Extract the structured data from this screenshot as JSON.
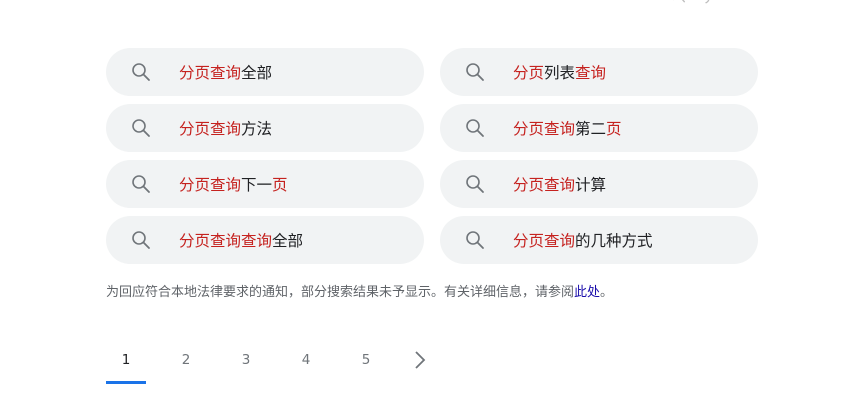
{
  "top_fragment": "ペ ア",
  "related_searches": [
    {
      "segments": [
        {
          "text": "分页查询",
          "hl": true
        },
        {
          "text": "全部",
          "hl": false
        }
      ]
    },
    {
      "segments": [
        {
          "text": "分页",
          "hl": true
        },
        {
          "text": "列表",
          "hl": false
        },
        {
          "text": "查询",
          "hl": true
        }
      ]
    },
    {
      "segments": [
        {
          "text": "分页查询",
          "hl": true
        },
        {
          "text": "方法",
          "hl": false
        }
      ]
    },
    {
      "segments": [
        {
          "text": "分页查询",
          "hl": true
        },
        {
          "text": "第二",
          "hl": false
        },
        {
          "text": "页",
          "hl": true
        }
      ]
    },
    {
      "segments": [
        {
          "text": "分页查询",
          "hl": true
        },
        {
          "text": "下一",
          "hl": false
        },
        {
          "text": "页",
          "hl": true
        }
      ]
    },
    {
      "segments": [
        {
          "text": "分页查询",
          "hl": true
        },
        {
          "text": "计算",
          "hl": false
        }
      ]
    },
    {
      "segments": [
        {
          "text": "分页查询查询",
          "hl": true
        },
        {
          "text": "全部",
          "hl": false
        }
      ]
    },
    {
      "segments": [
        {
          "text": "分页查询",
          "hl": true
        },
        {
          "text": "的几种方式",
          "hl": false
        }
      ]
    }
  ],
  "notice": {
    "text": "为回应符合本地法律要求的通知，部分搜索结果未予显示。有关详细信息，请参阅",
    "link_text": "此处",
    "suffix": "。"
  },
  "pagination": {
    "pages": [
      "1",
      "2",
      "3",
      "4",
      "5"
    ],
    "current": "1"
  },
  "icons": {
    "chip_icon": "search-icon",
    "next_icon": "chevron-right-icon"
  },
  "colors": {
    "highlight": "#c5221f",
    "chip_bg": "#f1f3f4",
    "link": "#1a0dab",
    "current_page_underline": "#1a73e8"
  }
}
